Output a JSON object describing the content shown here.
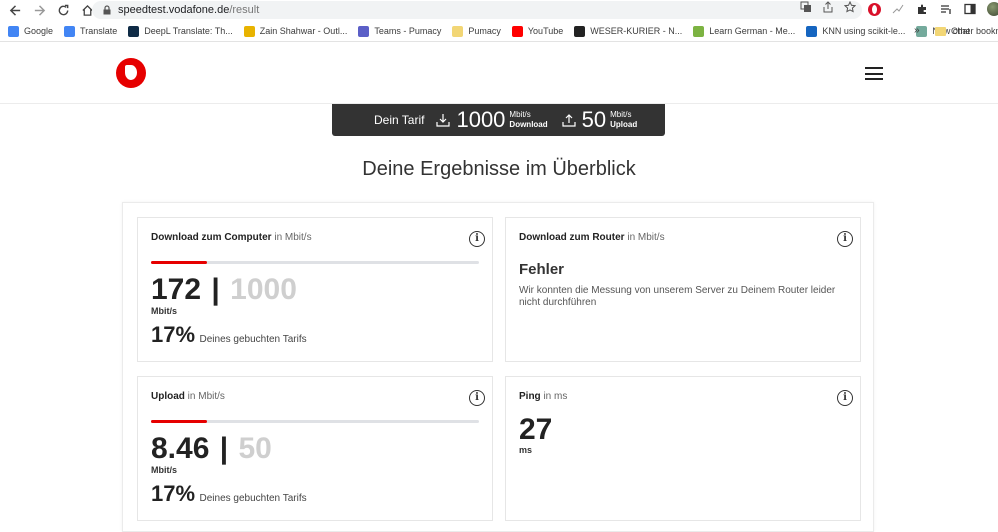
{
  "browser": {
    "url_host": "speedtest.vodafone.de",
    "url_path": "/result",
    "bookmarks": [
      {
        "label": "Google",
        "color": "#4285f4"
      },
      {
        "label": "Translate",
        "color": "#4285f4"
      },
      {
        "label": "DeepL Translate: Th...",
        "color": "#0f2b46"
      },
      {
        "label": "Zain Shahwar - Outl...",
        "color": "#e8b300"
      },
      {
        "label": "Teams - Pumacy",
        "color": "#5b5fc7"
      },
      {
        "label": "Pumacy",
        "color": "#f2d675"
      },
      {
        "label": "YouTube",
        "color": "#ff0000"
      },
      {
        "label": "WESER-KURIER - N...",
        "color": "#222222"
      },
      {
        "label": "Learn German - Me...",
        "color": "#7cb342"
      },
      {
        "label": "KNN using scikit-le...",
        "color": "#1565c0"
      },
      {
        "label": "New chat",
        "color": "#74aa9c"
      }
    ],
    "more_label": "»",
    "other_bookmarks": "Other bookm"
  },
  "plan": {
    "label": "Dein Tarif",
    "download_value": "1000",
    "download_unit": "Mbit/s",
    "download_label": "Download",
    "upload_value": "50",
    "upload_unit": "Mbit/s",
    "upload_label": "Upload"
  },
  "page_title": "Deine Ergebnisse im Überblick",
  "cards": {
    "download_computer": {
      "title": "Download zum Computer",
      "unit_text": "in Mbit/s",
      "value": "172",
      "max": "1000",
      "unit": "Mbit/s",
      "percent": "17%",
      "percent_label": "Deines gebuchten Tarifs",
      "fraction": 0.17
    },
    "download_router": {
      "title": "Download zum Router",
      "unit_text": "in Mbit/s",
      "error_title": "Fehler",
      "error_text": "Wir konnten die Messung von unserem Server zu Deinem Router leider nicht durchführen"
    },
    "upload": {
      "title": "Upload",
      "unit_text": "in Mbit/s",
      "value": "8.46",
      "max": "50",
      "unit": "Mbit/s",
      "percent": "17%",
      "percent_label": "Deines gebuchten Tarifs",
      "fraction": 0.17
    },
    "ping": {
      "title": "Ping",
      "unit_text": "in ms",
      "value": "27",
      "unit": "ms"
    }
  },
  "colors": {
    "accent": "#e60000",
    "plan_bar": "#333333"
  }
}
